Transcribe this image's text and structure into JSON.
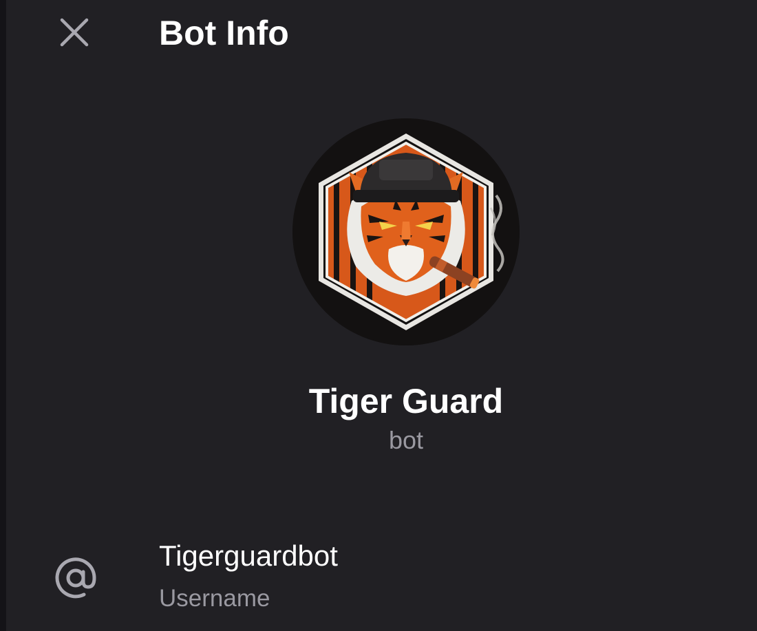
{
  "header": {
    "title": "Bot Info",
    "close_icon": "close-icon"
  },
  "profile": {
    "name": "Tiger Guard",
    "status": "bot",
    "avatar_icon": "tiger-avatar"
  },
  "info": {
    "username": {
      "value": "Tigerguardbot",
      "label": "Username",
      "icon": "at-sign-icon"
    }
  },
  "colors": {
    "background": "#212024",
    "text_primary": "#ffffff",
    "text_secondary": "#9a99a1",
    "icon": "#a9a8b0",
    "avatar_accent": "#e0611c"
  }
}
